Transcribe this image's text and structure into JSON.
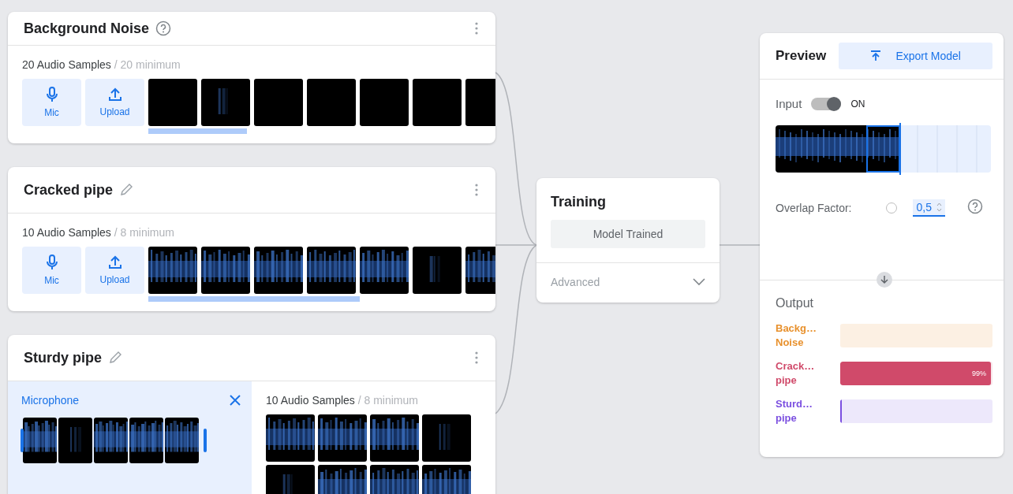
{
  "classes": [
    {
      "name": "Background Noise",
      "editable": false,
      "sample_count": "20 Audio Samples",
      "minimum": "/ 20 minimum",
      "buttons": [
        {
          "kind": "mic",
          "label": "Mic"
        },
        {
          "kind": "upload",
          "label": "Upload"
        }
      ],
      "samples": [
        {
          "kind": "silent"
        },
        {
          "kind": "faint"
        },
        {
          "kind": "silent"
        },
        {
          "kind": "silent"
        },
        {
          "kind": "silent"
        },
        {
          "kind": "silent"
        },
        {
          "kind": "silent"
        }
      ]
    },
    {
      "name": "Cracked pipe",
      "editable": true,
      "sample_count": "10 Audio Samples",
      "minimum": "/ 8 minimum",
      "buttons": [
        {
          "kind": "mic",
          "label": "Mic"
        },
        {
          "kind": "upload",
          "label": "Upload"
        }
      ],
      "samples": [
        {
          "kind": "loud"
        },
        {
          "kind": "loud"
        },
        {
          "kind": "loud"
        },
        {
          "kind": "loud"
        },
        {
          "kind": "loud"
        },
        {
          "kind": "faint"
        },
        {
          "kind": "loud"
        }
      ]
    },
    {
      "name": "Sturdy pipe",
      "editable": true,
      "recorder": {
        "title": "Microphone",
        "frames": [
          {
            "kind": "loud"
          },
          {
            "kind": "faint"
          },
          {
            "kind": "loud"
          },
          {
            "kind": "loud"
          },
          {
            "kind": "loud"
          }
        ]
      },
      "sample_count": "10 Audio Samples",
      "minimum": "/ 8 minimum",
      "samples": [
        {
          "kind": "loud"
        },
        {
          "kind": "loud"
        },
        {
          "kind": "loud"
        },
        {
          "kind": "faint"
        },
        {
          "kind": "faint"
        },
        {
          "kind": "loud"
        },
        {
          "kind": "loud"
        },
        {
          "kind": "loud"
        }
      ]
    }
  ],
  "training": {
    "title": "Training",
    "button": "Model Trained",
    "advanced": "Advanced",
    "expanded": false
  },
  "preview": {
    "title": "Preview",
    "export_button": "Export Model",
    "input_label": "Input",
    "input_on": true,
    "input_state": "ON",
    "overlap_label": "Overlap Factor:",
    "overlap_selected": false,
    "overlap_value": "0,5",
    "output_title": "Output",
    "outputs": [
      {
        "label": "Backg… Noise",
        "color": "#e8912d",
        "level": 0
      },
      {
        "label": "Crack… pipe",
        "color": "#d04a6a",
        "level": 0.99,
        "reading": "99%"
      },
      {
        "label": "Sturd… pipe",
        "color": "#7b4fe0",
        "level": 0.005
      }
    ]
  }
}
